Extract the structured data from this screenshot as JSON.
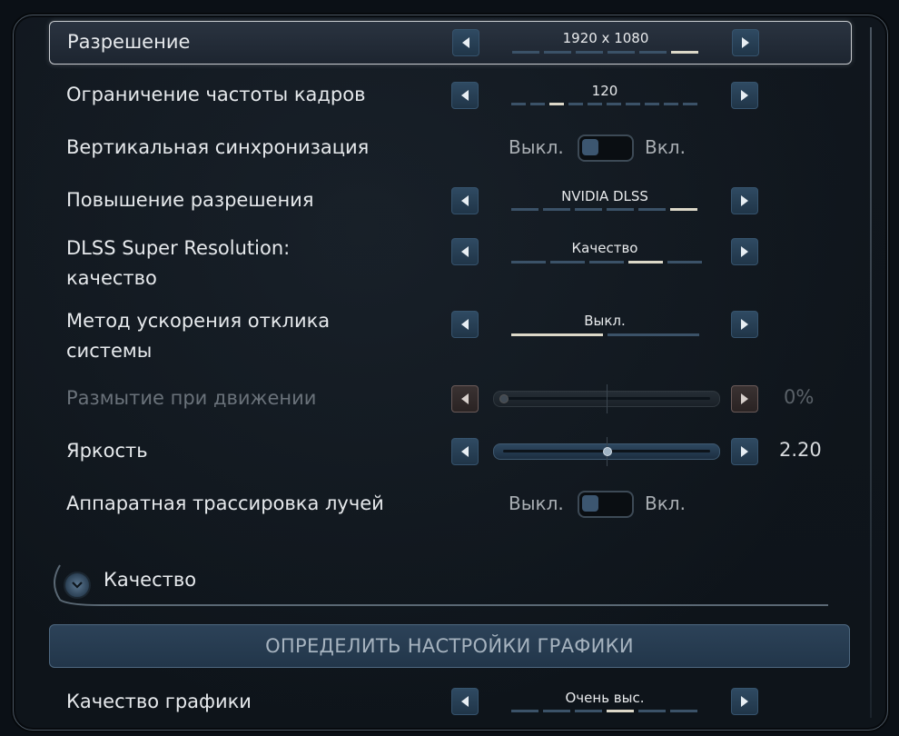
{
  "settings": {
    "resolution": {
      "label": "Разрешение",
      "value": "1920 x 1080",
      "segments": 6,
      "active": 5
    },
    "fps_limit": {
      "label": "Ограничение частоты кадров",
      "value": "120",
      "segments": 10,
      "active": 2
    },
    "vsync": {
      "label": "Вертикальная синхронизация",
      "off": "Выкл.",
      "on": "Вкл."
    },
    "upscaling": {
      "label": "Повышение разрешения",
      "value": "NVIDIA DLSS",
      "segments": 6,
      "active": 5
    },
    "dlss_quality": {
      "label_line1": "DLSS Super Resolution:",
      "label_line2": "качество",
      "value": "Качество",
      "segments": 5,
      "active": 3
    },
    "latency": {
      "label_line1": "Метод ускорения отклика",
      "label_line2": "системы",
      "value": "Выкл.",
      "segments": 2,
      "active": 0
    },
    "motion_blur": {
      "label": "Размытие при движении",
      "value": "0%",
      "level": 0.0
    },
    "brightness": {
      "label": "Яркость",
      "value": "2.20",
      "level": 0.5
    },
    "ray_tracing": {
      "label": "Аппаратная трассировка лучей",
      "off": "Выкл.",
      "on": "Вкл."
    }
  },
  "quality_section": {
    "title": "Качество"
  },
  "detect_button": {
    "label": "ОПРЕДЕЛИТЬ НАСТРОЙКИ ГРАФИКИ"
  },
  "graphics_quality": {
    "label": "Качество графики",
    "value": "Очень выс.",
    "segments": 6,
    "active": 3
  },
  "colors": {
    "accent": "#2f4a62",
    "segment_on": "#dcd8c8",
    "segment_off": "#3b5268"
  },
  "icons": {
    "left": "chevron-left-icon",
    "right": "chevron-right-icon",
    "expand": "chevron-down-icon"
  }
}
